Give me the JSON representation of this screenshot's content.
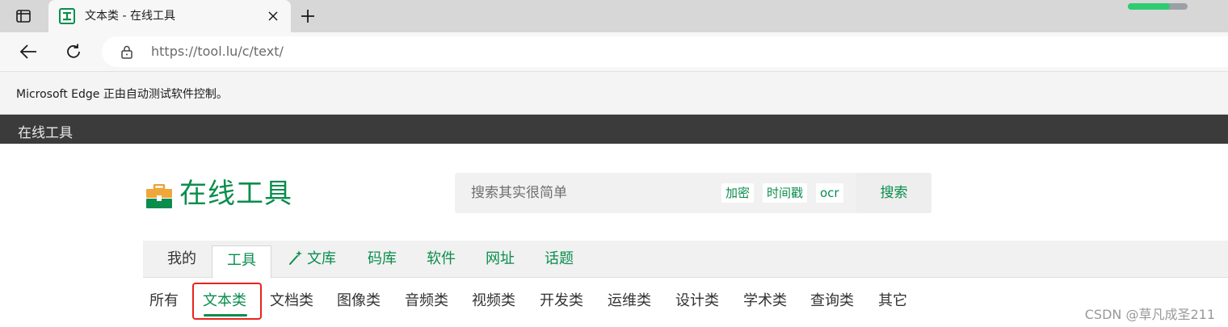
{
  "browser": {
    "tab": {
      "title": "文本类 - 在线工具",
      "favicon": "tool-favicon-icon"
    },
    "page_load_progress_percent": 70,
    "address_bar": {
      "url_host": "https://tool.lu",
      "url_path": "/c/text/"
    },
    "infobar_text": "Microsoft Edge 正由自动测试软件控制。"
  },
  "site": {
    "topbar_title": "在线工具",
    "logo_text": "在线工具",
    "search": {
      "placeholder": "搜索其实很简单",
      "quick_tags": [
        "加密",
        "时间戳",
        "ocr"
      ],
      "button_label": "搜索"
    },
    "nav": {
      "items": [
        {
          "label": "我的"
        },
        {
          "label": "工具"
        },
        {
          "label": "文库",
          "icon": "magic-wand-icon"
        },
        {
          "label": "码库"
        },
        {
          "label": "软件"
        },
        {
          "label": "网址"
        },
        {
          "label": "话题"
        }
      ],
      "active": "工具"
    },
    "subnav": {
      "items": [
        "所有",
        "文本类",
        "文档类",
        "图像类",
        "音频类",
        "视频类",
        "开发类",
        "运维类",
        "设计类",
        "学术类",
        "查询类",
        "其它"
      ],
      "active": "文本类"
    },
    "colors": {
      "brand_green": "#0a8d4d",
      "topbar_dark": "#3b3b3b",
      "highlight_red": "#e8231d"
    }
  },
  "watermark": "CSDN @草凡成圣211"
}
